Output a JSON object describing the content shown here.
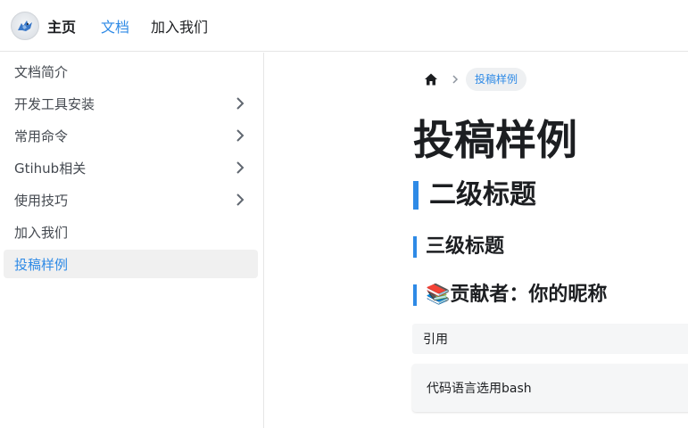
{
  "navbar": {
    "brand": "主页",
    "links": [
      {
        "label": "文档",
        "active": true
      },
      {
        "label": "加入我们",
        "active": false
      }
    ]
  },
  "sidebar": {
    "items": [
      {
        "label": "文档简介",
        "has_children": false,
        "active": false
      },
      {
        "label": "开发工具安装",
        "has_children": true,
        "active": false
      },
      {
        "label": "常用命令",
        "has_children": true,
        "active": false
      },
      {
        "label": "Gtihub相关",
        "has_children": true,
        "active": false
      },
      {
        "label": "使用技巧",
        "has_children": true,
        "active": false
      },
      {
        "label": "加入我们",
        "has_children": false,
        "active": false
      },
      {
        "label": "投稿样例",
        "has_children": false,
        "active": true
      }
    ]
  },
  "breadcrumb": {
    "current": "投稿样例"
  },
  "content": {
    "h1": "投稿样例",
    "h2": "二级标题",
    "h3": "三级标题",
    "h4_emoji": "📚",
    "h4": "贡献者：你的昵称",
    "blockquote": "引用",
    "code": "代码语言选用bash"
  },
  "colors": {
    "accent": "#2e8ae6",
    "active_bg": "#f0f0f0"
  }
}
